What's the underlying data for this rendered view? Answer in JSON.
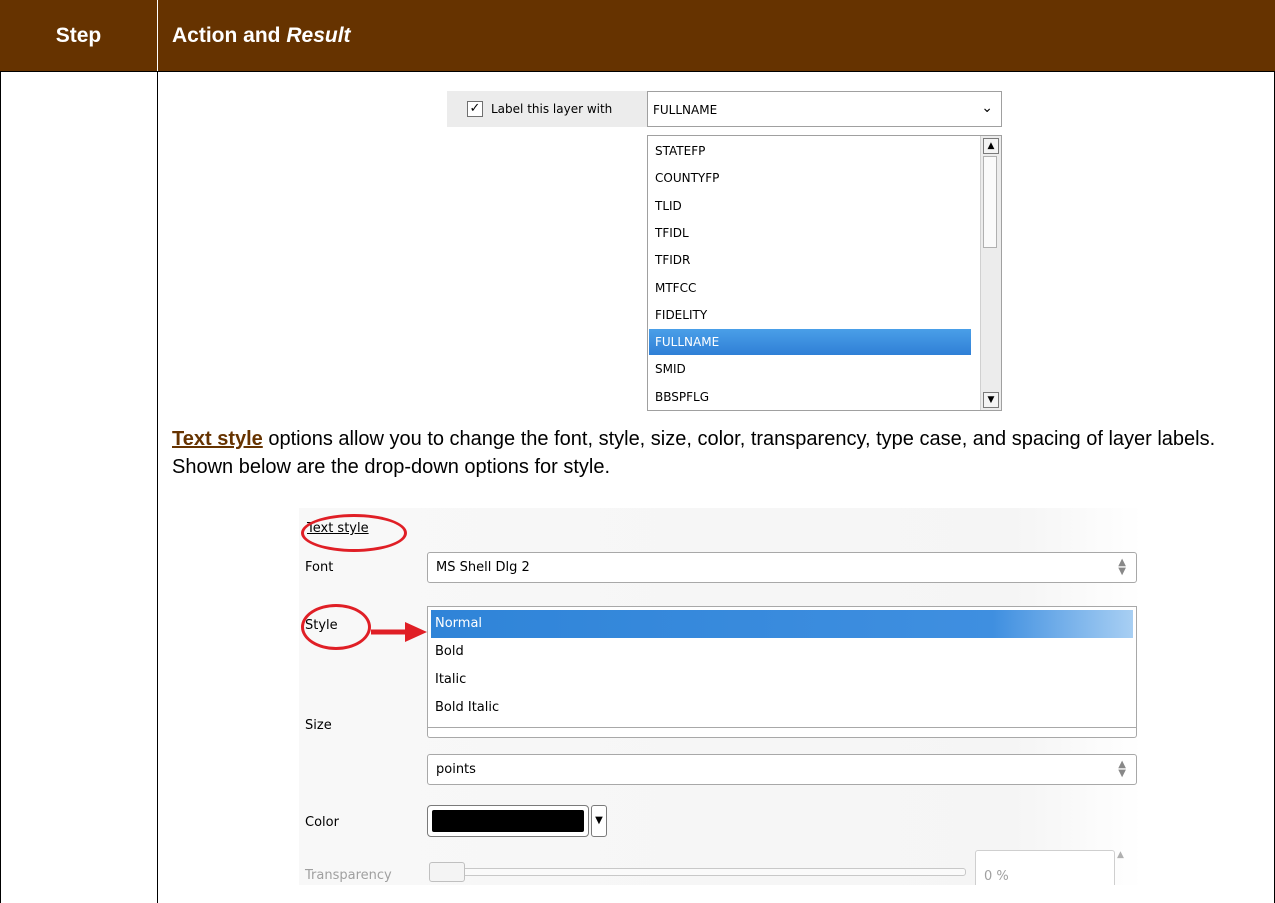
{
  "header": {
    "step_label": "Step",
    "action_label": "Action and ",
    "result_label": "Result"
  },
  "label_panel": {
    "checkbox_label": "Label this layer with",
    "selected_field": "FULLNAME",
    "fields": [
      "STATEFP",
      "COUNTYFP",
      "TLID",
      "TFIDL",
      "TFIDR",
      "MTFCC",
      "FIDELITY",
      "FULLNAME",
      "SMID",
      "BBSPFLG"
    ],
    "selected_index": 7
  },
  "paragraph": {
    "link_text": "Text style",
    "body_text": " options allow you to change the font, style, size, color, transparency, type case, and spacing of layer labels. Shown below are the drop-down options for style."
  },
  "text_style_panel": {
    "title": "Text style",
    "font_label": "Font",
    "font_value": "MS Shell Dlg 2",
    "style_label": "Style",
    "style_options": [
      "Normal",
      "Bold",
      "Italic",
      "Bold Italic"
    ],
    "style_selected_index": 0,
    "size_label": "Size",
    "units_value": "points",
    "color_label": "Color",
    "color_value": "#000000",
    "transparency_label": "Transparency",
    "transparency_value": "0 %"
  },
  "colors": {
    "header_bg": "#663300",
    "highlight": "#663300",
    "annotation": "#e01f26",
    "selection": "#3399ff"
  }
}
